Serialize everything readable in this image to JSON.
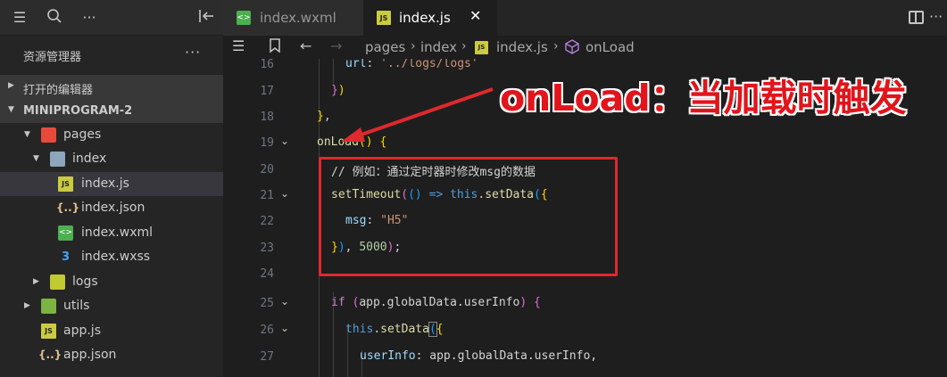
{
  "sidebar": {
    "title": "资源管理器",
    "more_label": "···",
    "sections": [
      {
        "label": "打开的编辑器",
        "expanded": false
      },
      {
        "label": "MINIPROGRAM-2",
        "expanded": true
      }
    ],
    "tree": [
      {
        "name": "pages",
        "icon": "folder-pages-icon",
        "kind": "folder",
        "expanded": true
      },
      {
        "name": "index",
        "icon": "folder-index-icon",
        "kind": "folder",
        "expanded": true
      },
      {
        "name": "index.js",
        "icon": "js-file-icon",
        "kind": "file",
        "active": true
      },
      {
        "name": "index.json",
        "icon": "json-file-icon",
        "kind": "file"
      },
      {
        "name": "index.wxml",
        "icon": "wxml-file-icon",
        "kind": "file"
      },
      {
        "name": "index.wxss",
        "icon": "wxss-file-icon",
        "kind": "file"
      },
      {
        "name": "logs",
        "icon": "folder-logs-icon",
        "kind": "folder",
        "expanded": false
      },
      {
        "name": "utils",
        "icon": "folder-utils-icon",
        "kind": "folder",
        "expanded": false
      },
      {
        "name": "app.js",
        "icon": "js-file-icon",
        "kind": "file"
      },
      {
        "name": "app.json",
        "icon": "json-file-icon",
        "kind": "file"
      }
    ]
  },
  "tabs": [
    {
      "label": "index.wxml",
      "icon": "wxml-file-icon",
      "active": false
    },
    {
      "label": "index.js",
      "icon": "js-file-icon",
      "active": true
    }
  ],
  "breadcrumb": [
    "pages",
    "index",
    "index.js",
    "onLoad"
  ],
  "editor": {
    "lines": [
      {
        "n": "16",
        "text": "url: '../logs/logs'"
      },
      {
        "n": "17",
        "text": "})"
      },
      {
        "n": "18",
        "text": "},"
      },
      {
        "n": "19",
        "text": "onLoad() {"
      },
      {
        "n": "20",
        "text": "// 例如：通过定时器时修改msg的数据"
      },
      {
        "n": "21",
        "text": "setTimeout(() => this.setData({"
      },
      {
        "n": "22",
        "text": "msg: \"H5\""
      },
      {
        "n": "23",
        "text": "}), 5000);"
      },
      {
        "n": "24",
        "text": ""
      },
      {
        "n": "25",
        "text": "if (app.globalData.userInfo) {"
      },
      {
        "n": "26",
        "text": "this.setData({"
      },
      {
        "n": "27",
        "text": "userInfo: app.globalData.userInfo,"
      }
    ]
  },
  "annotation": "onLoad：当加载时触发",
  "colors": {
    "annotation": "#e1151b",
    "highlight_border": "#e0282e",
    "keyword": "#c586c0",
    "function": "#dcdcaa",
    "string": "#ce9178",
    "number": "#b5cea8",
    "comment": "#6a9955"
  }
}
